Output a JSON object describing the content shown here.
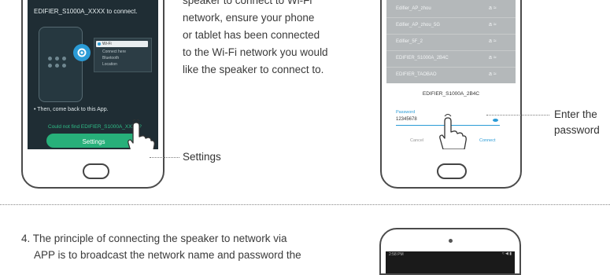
{
  "left_phone": {
    "header_text": "EDIFIER_S1000A_XXXX to connect.",
    "popup_items": [
      "Wi-Fi",
      "Connect here",
      "Bluetooth",
      "Location"
    ],
    "then_text": "• Then, come back to this App.",
    "link_text": "Could not find EDIFIER_S1000A_XXXX?",
    "settings_button": "Settings"
  },
  "instructions": {
    "lines": [
      "speaker to connect to Wi-Fi",
      "network, ensure your phone",
      "or tablet has been connected",
      "to the Wi-Fi network you would",
      "like the speaker to connect to."
    ]
  },
  "callouts": {
    "settings": "Settings",
    "password_line1": "Enter the",
    "password_line2": "password"
  },
  "right_phone": {
    "networks": [
      {
        "name": "Edifier_AP_zhou",
        "signal": "a ≈"
      },
      {
        "name": "Edifier_AP_zhou_5G",
        "signal": "a ≈"
      },
      {
        "name": "Edifier_5F_2",
        "signal": "a ≈"
      },
      {
        "name": "EDIFIER_S1000A_2B4C",
        "signal": "a ≈"
      },
      {
        "name": "EDIFIER_TAOBAO",
        "signal": "a ≈"
      }
    ],
    "dialog_title": "EDIFIER_S1000A_2B4C",
    "password_label": "Password",
    "password_value": "12345678",
    "cancel": "Cancel",
    "connect": "Connect"
  },
  "step4": {
    "line1": "4. The principle of connecting the speaker to network via",
    "line2": "APP is to broadcast the network name and password the"
  },
  "bottom_phone": {
    "status_left": "2:58 PM",
    "status_right": "≈ ◀ ▮"
  },
  "colors": {
    "screen_dark": "#1f2d34",
    "button_green": "#27b07a",
    "link_green": "#2fbf88",
    "list_bg": "#b4b8ba",
    "accent_blue": "#2a9bd6",
    "dotted_line": "#7a7a7a"
  }
}
